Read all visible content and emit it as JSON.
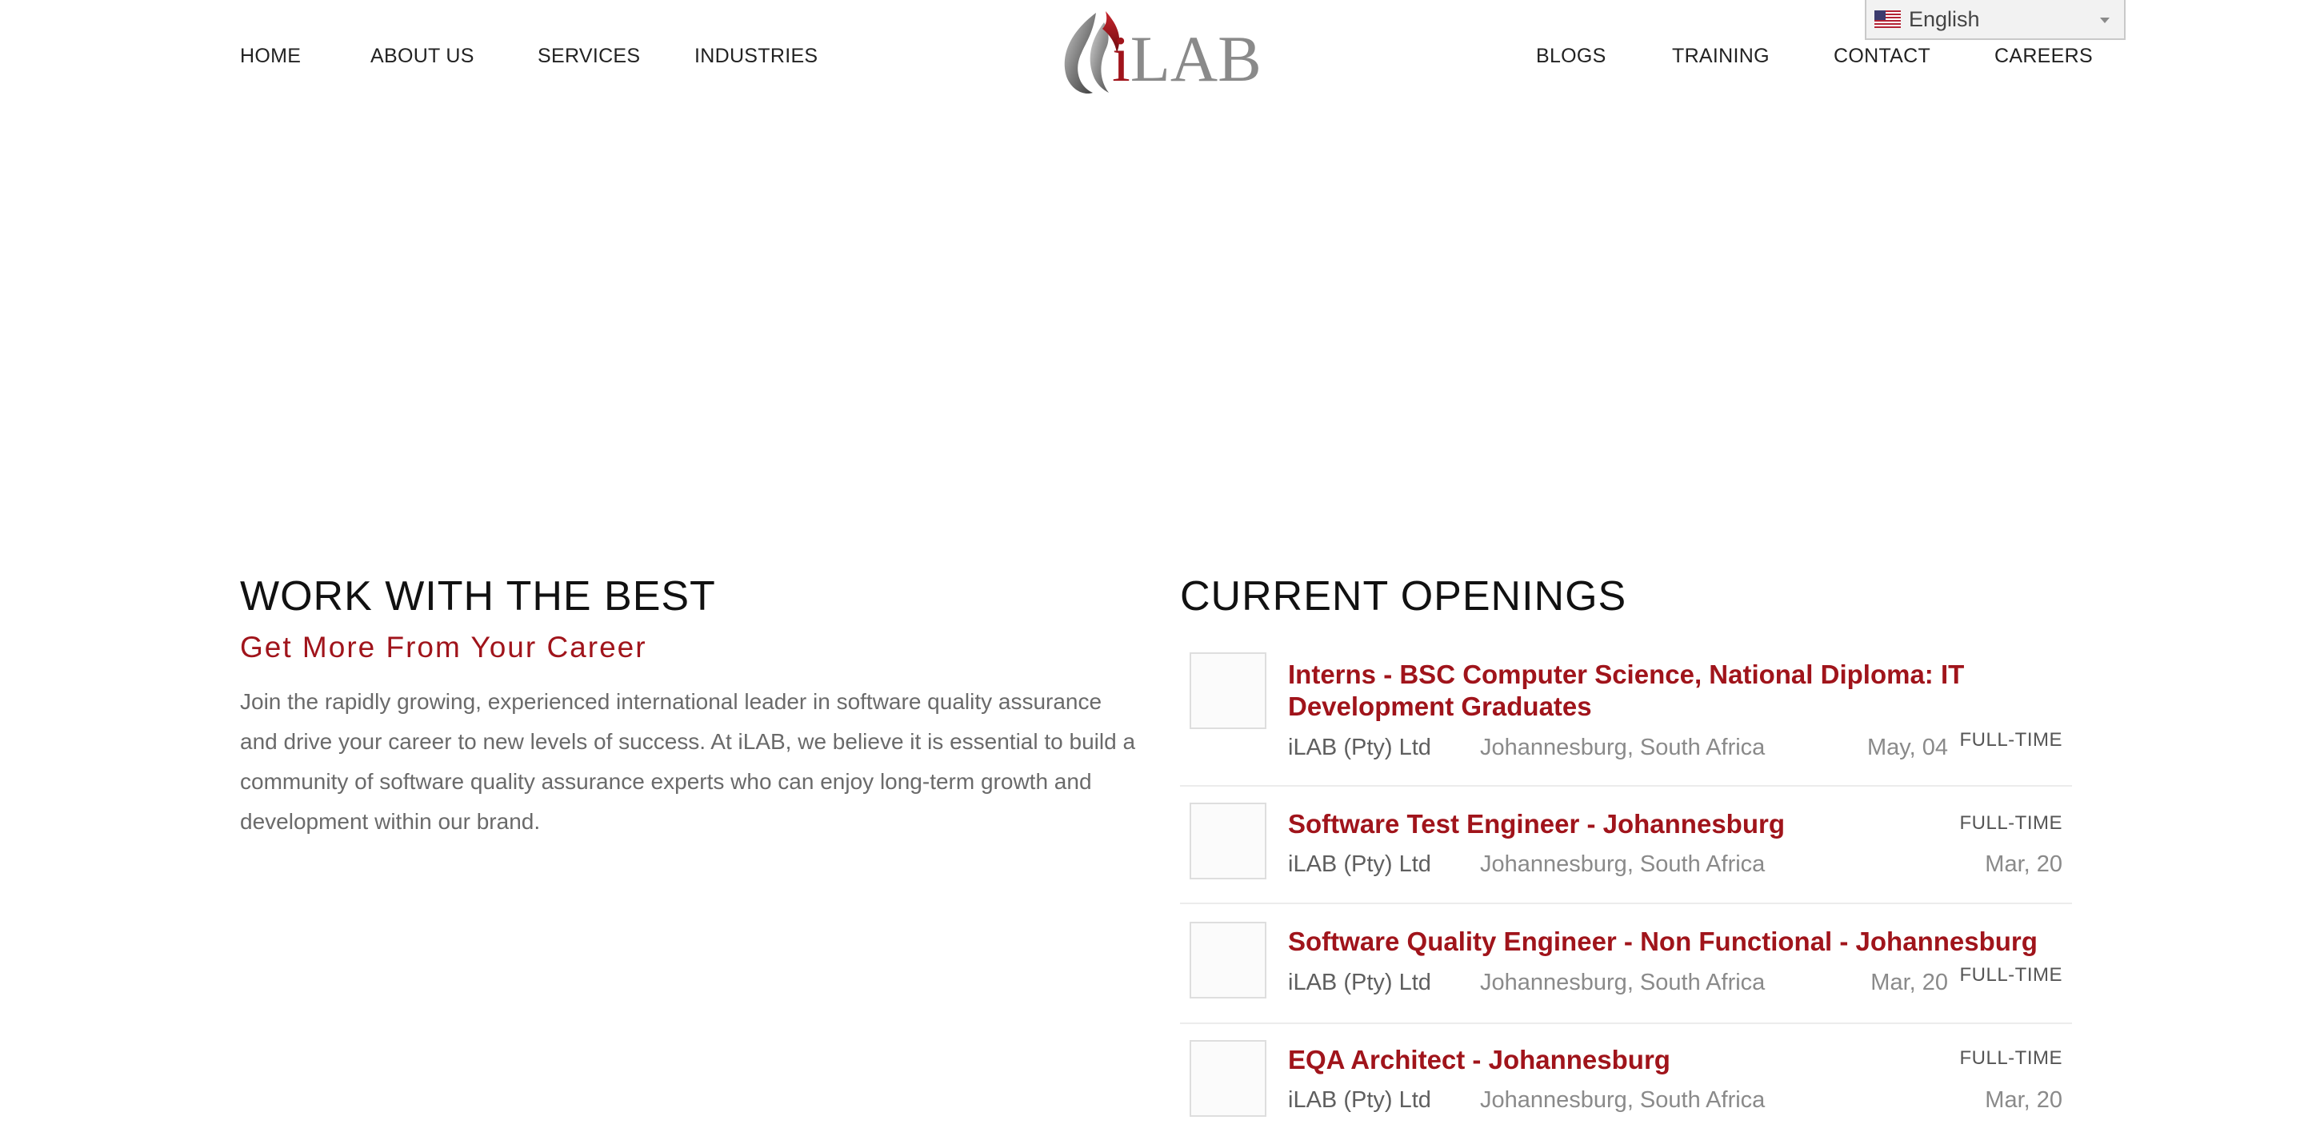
{
  "nav": {
    "left": [
      "HOME",
      "ABOUT US",
      "SERVICES",
      "INDUSTRIES"
    ],
    "right": [
      "BLOGS",
      "TRAINING",
      "CONTACT",
      "CAREERS"
    ],
    "logo_text": "iLAB"
  },
  "language": {
    "selected": "English",
    "flag": "us-flag-icon"
  },
  "intro": {
    "title": "WORK WITH THE BEST",
    "subtitle": "Get More From Your Career",
    "body": "Join the rapidly growing, experienced international leader in software quality assurance and drive your career to new levels of success.  At iLAB, we believe it is essential to build a community of software quality assurance experts who can enjoy long-term growth and development within our brand."
  },
  "openings": {
    "title": "CURRENT OPENINGS",
    "jobs": [
      {
        "title": "Interns - BSC Computer Science, National Diploma: IT Development Graduates",
        "company": "iLAB (Pty) Ltd",
        "location": "Johannesburg, South Africa",
        "date": "May, 04",
        "type": "FULL-TIME"
      },
      {
        "title": "Software Test Engineer - Johannesburg",
        "company": "iLAB (Pty) Ltd",
        "location": "Johannesburg, South Africa",
        "date": "Mar, 20",
        "type": "FULL-TIME"
      },
      {
        "title": "Software Quality Engineer - Non Functional - Johannesburg",
        "company": "iLAB (Pty) Ltd",
        "location": "Johannesburg, South Africa",
        "date": "Mar, 20",
        "type": "FULL-TIME"
      },
      {
        "title": "EQA Architect - Johannesburg",
        "company": "iLAB (Pty) Ltd",
        "location": "Johannesburg, South Africa",
        "date": "Mar, 20",
        "type": "FULL-TIME"
      }
    ]
  },
  "colors": {
    "brand_red": "#a0141b",
    "text_dark": "#111111",
    "text_muted": "#6a6a6a"
  }
}
